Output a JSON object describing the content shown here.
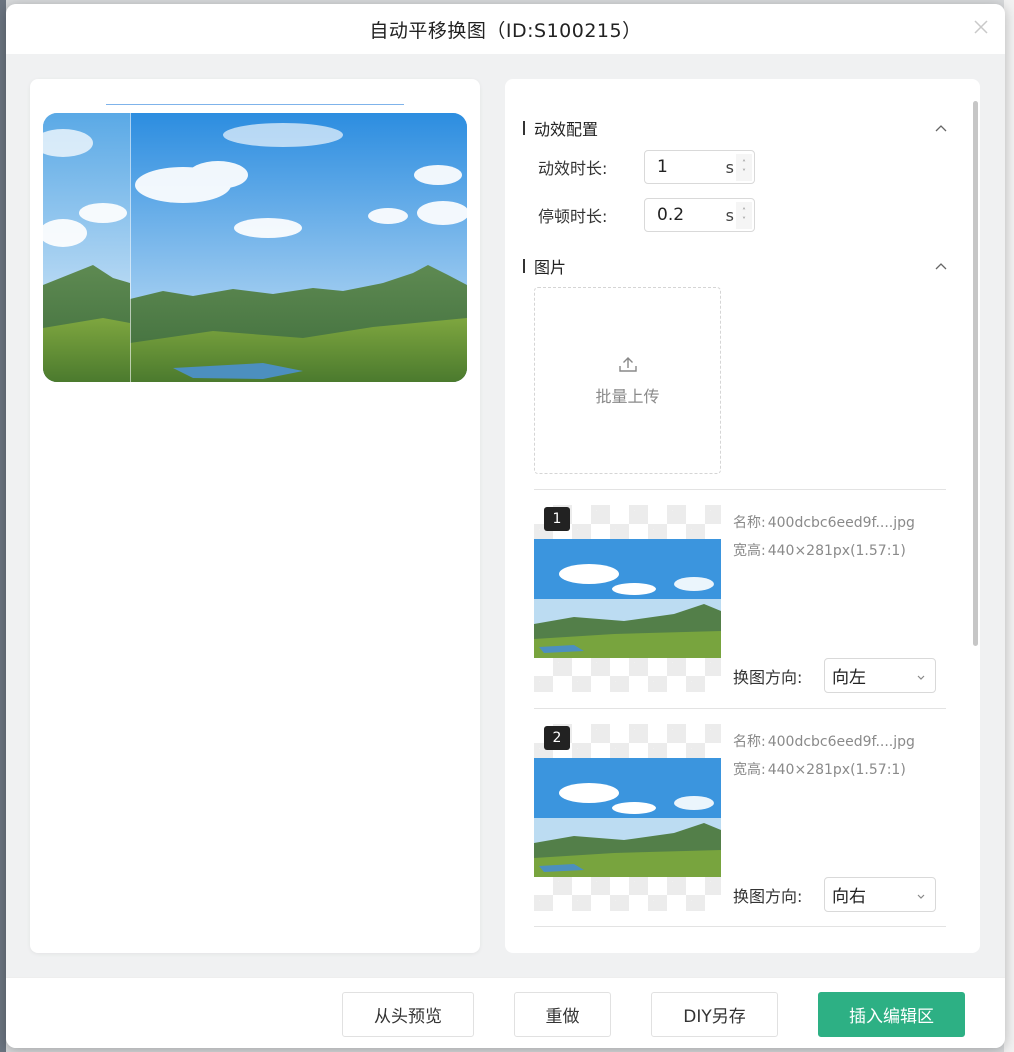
{
  "modal": {
    "title": "自动平移换图（ID:S100215）",
    "close_icon": "close-icon"
  },
  "preview": {
    "image_description": "",
    "progress": 1.0
  },
  "config": {
    "section_title": "动效配置",
    "duration_label": "动效时长:",
    "duration_value": "1",
    "duration_unit": "s",
    "pause_label": "停顿时长:",
    "pause_value": "0.2",
    "pause_unit": "s"
  },
  "images": {
    "section_title": "图片",
    "upload_label": "批量上传",
    "items": [
      {
        "index": "1",
        "name_key": "名称:",
        "name_value": "400dcbc6eed9f....jpg",
        "size_key": "宽高:",
        "size_value": "440×281px(1.57:1)",
        "direction_label": "换图方向:",
        "direction_value": "向左"
      },
      {
        "index": "2",
        "name_key": "名称:",
        "name_value": "400dcbc6eed9f....jpg",
        "size_key": "宽高:",
        "size_value": "440×281px(1.57:1)",
        "direction_label": "换图方向:",
        "direction_value": "向右"
      }
    ]
  },
  "footer": {
    "replay_label": "从头预览",
    "redo_label": "重做",
    "diy_save_label": "DIY另存",
    "insert_label": "插入编辑区"
  },
  "colors": {
    "primary": "#2db084",
    "accent_line": "#7fb3ea"
  }
}
